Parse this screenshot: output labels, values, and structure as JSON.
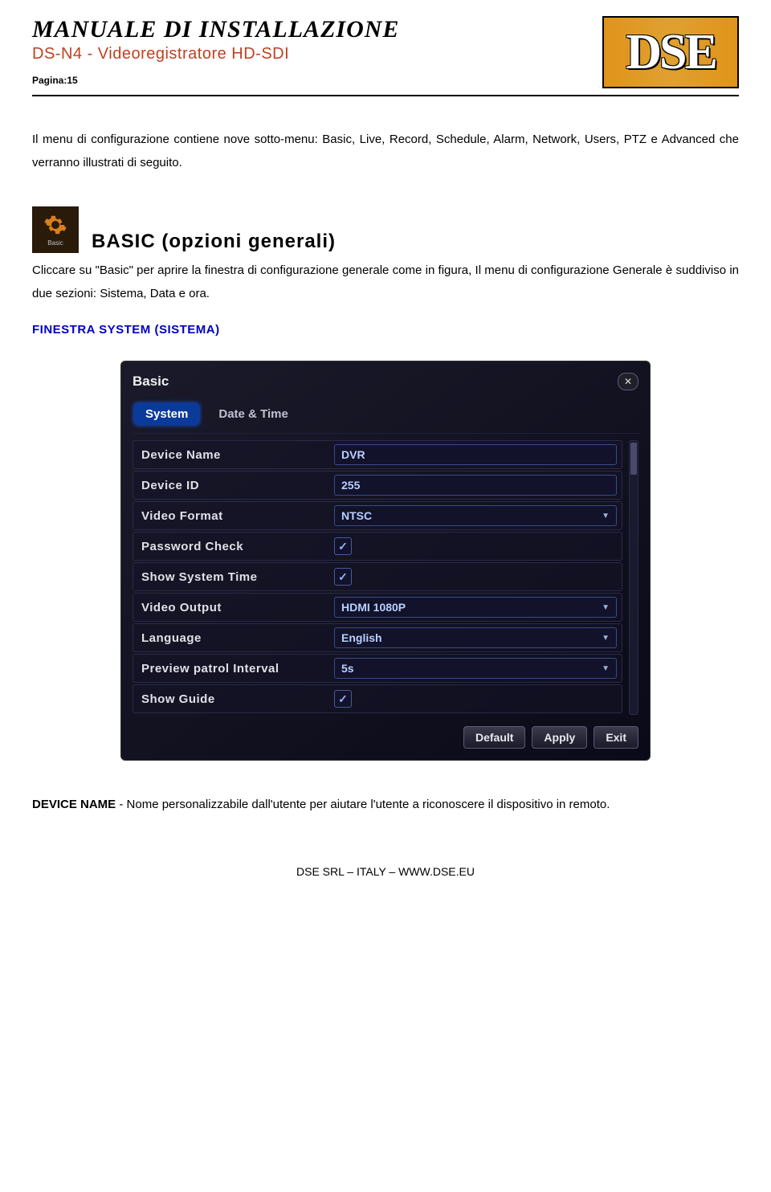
{
  "header": {
    "title": "MANUALE DI INSTALLAZIONE",
    "subtitle": "DS-N4 - Videoregistratore HD-SDI",
    "page_label": "Pagina",
    "page_number": ":15"
  },
  "logo": {
    "text": "DSE"
  },
  "intro_paragraph": "Il menu di configurazione contiene nove sotto-menu: Basic, Live, Record, Schedule, Alarm, Network, Users, PTZ e Advanced che verranno illustrati di seguito.",
  "basic_icon_label": "Basic",
  "section_heading": "BASIC (opzioni generali)",
  "section_paragraph": "Cliccare su \"Basic\" per aprire la finestra di configurazione generale come in figura, Il menu di configurazione Generale è suddiviso in due sezioni: Sistema, Data e ora.",
  "subheading": "FINESTRA SYSTEM (SISTEMA)",
  "panel": {
    "title": "Basic",
    "tabs": [
      "System",
      "Date & Time"
    ],
    "active_tab": 0,
    "rows": [
      {
        "label": "Device Name",
        "type": "text",
        "value": "DVR"
      },
      {
        "label": "Device ID",
        "type": "text",
        "value": "255"
      },
      {
        "label": "Video Format",
        "type": "select",
        "value": "NTSC"
      },
      {
        "label": "Password Check",
        "type": "checkbox",
        "checked": true
      },
      {
        "label": "Show System Time",
        "type": "checkbox",
        "checked": true
      },
      {
        "label": "Video Output",
        "type": "select",
        "value": "HDMI 1080P"
      },
      {
        "label": "Language",
        "type": "select",
        "value": "English"
      },
      {
        "label": "Preview patrol Interval",
        "type": "select",
        "value": "5s"
      },
      {
        "label": "Show Guide",
        "type": "checkbox",
        "checked": true
      }
    ],
    "buttons": [
      "Default",
      "Apply",
      "Exit"
    ]
  },
  "device_name_para": {
    "bold": "DEVICE NAME",
    "rest": " - Nome personalizzabile dall'utente per aiutare l'utente a riconoscere il dispositivo in remoto."
  },
  "footer": "DSE SRL – ITALY – WWW.DSE.EU"
}
